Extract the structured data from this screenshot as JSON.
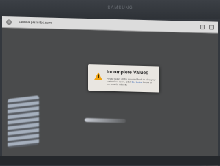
{
  "monitor": {
    "brand": "SAMSUNG"
  },
  "browser": {
    "url": "sabrina.plexsites.com",
    "favicon": "info-icon"
  },
  "dialog": {
    "icon": "warning-icon",
    "title": "Incomplete Values",
    "body_prefix": "Please select all the required fields to view your customized score. Click",
    "link_text": "this button",
    "body_suffix": "below to see what is missing."
  }
}
